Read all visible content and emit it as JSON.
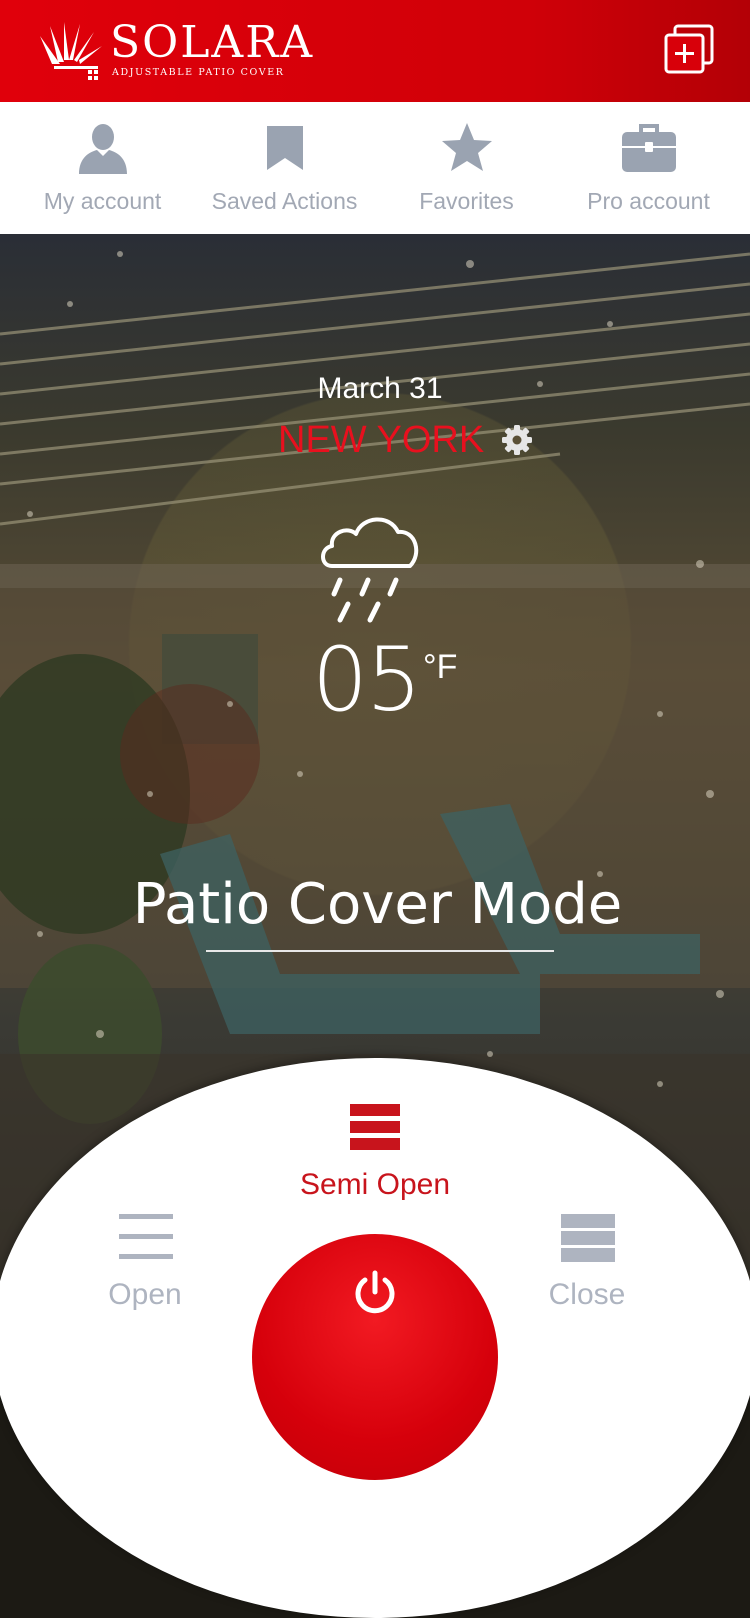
{
  "header": {
    "brand": "SOLARA",
    "tagline": "ADJUSTABLE PATIO COVER",
    "add_icon": "plus-square-icon",
    "color": "#e0000b"
  },
  "nav": {
    "items": [
      {
        "label": "My account",
        "icon": "user-icon"
      },
      {
        "label": "Saved Actions",
        "icon": "bookmark-icon"
      },
      {
        "label": "Favorites",
        "icon": "star-icon"
      },
      {
        "label": "Pro account",
        "icon": "briefcase-icon"
      }
    ],
    "icon_color": "#9aa3b1"
  },
  "weather": {
    "date": "March 31",
    "city": "NEW YORK",
    "condition_icon": "cloud-rain-icon",
    "temperature": "05",
    "unit": "°F"
  },
  "mode": {
    "title": "Patio Cover Mode",
    "options": [
      {
        "label": "Semi Open",
        "icon": "semi-open-icon",
        "selected": true
      },
      {
        "label": "Open",
        "icon": "open-icon",
        "selected": false
      },
      {
        "label": "Close",
        "icon": "close-mode-icon",
        "selected": false
      }
    ],
    "power_icon": "power-icon",
    "accent": "#c8141c",
    "inactive": "#aeb4c0"
  }
}
